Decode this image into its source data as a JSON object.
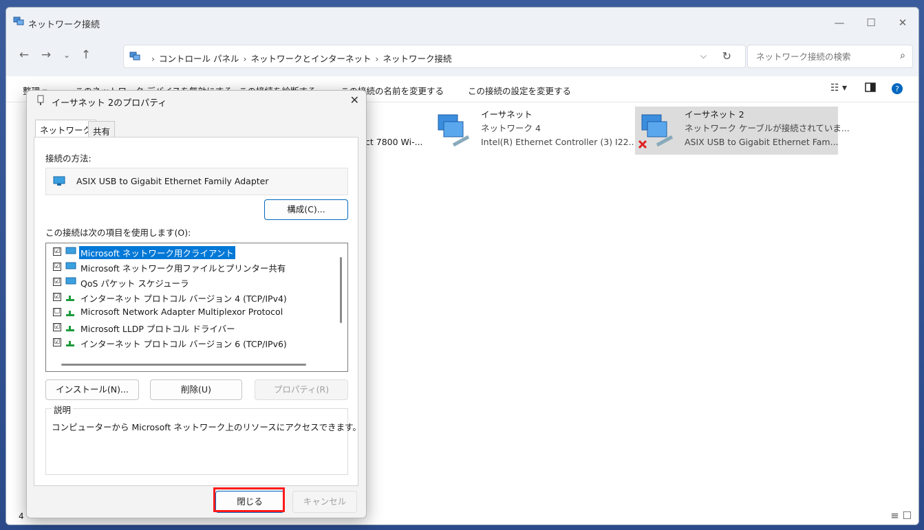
{
  "explorer": {
    "window_title": "ネットワーク接続",
    "breadcrumbs": [
      "コントロール パネル",
      "ネットワークとインターネット",
      "ネットワーク接続"
    ],
    "search_placeholder": "ネットワーク接続の検索",
    "commands": [
      "整理 ▾",
      "このネットワーク デバイスを無効にする",
      "この接続を診断する",
      "この接続の名前を変更する",
      "この接続の設定を変更する"
    ],
    "connections": [
      {
        "name": "",
        "line2": "",
        "line3": "ct 7800 Wi-..."
      },
      {
        "name": "イーサネット",
        "line2": "ネットワーク 4",
        "line3": "Intel(R) Ethernet Controller (3) I22..."
      },
      {
        "name": "イーサネット 2",
        "line2": "ネットワーク ケーブルが接続されていま...",
        "line3": "ASIX USB to Gigabit Ethernet Fam..."
      }
    ],
    "status_count": "4"
  },
  "dialog": {
    "title": "イーサネット 2のプロパティ",
    "tabs": [
      "ネットワーク",
      "共有"
    ],
    "connect_using_label": "接続の方法:",
    "adapter_name": "ASIX USB to Gigabit Ethernet Family Adapter",
    "configure_button": "構成(C)...",
    "items_label": "この接続は次の項目を使用します(O):",
    "items": [
      {
        "label": "Microsoft ネットワーク用クライアント",
        "checked": "☑"
      },
      {
        "label": "Microsoft ネットワーク用ファイルとプリンター共有",
        "checked": "☑"
      },
      {
        "label": "QoS パケット スケジューラ",
        "checked": "☑"
      },
      {
        "label": "インターネット プロトコル バージョン 4 (TCP/IPv4)",
        "checked": "☑"
      },
      {
        "label": "Microsoft Network Adapter Multiplexor Protocol",
        "checked": "☐"
      },
      {
        "label": "Microsoft LLDP プロトコル ドライバー",
        "checked": "☑"
      },
      {
        "label": "インターネット プロトコル バージョン 6 (TCP/IPv6)",
        "checked": "☑"
      }
    ],
    "install_button": "インストール(N)...",
    "uninstall_button": "削除(U)",
    "properties_button": "プロパティ(R)",
    "description_legend": "説明",
    "description_text": "コンピューターから Microsoft ネットワーク上のリソースにアクセスできます。",
    "close_button": "閉じる",
    "cancel_button": "キャンセル"
  },
  "colors": {
    "selection": "#0078d7",
    "highlight_box": "#ff1a1a",
    "accent": "#0067c0"
  }
}
